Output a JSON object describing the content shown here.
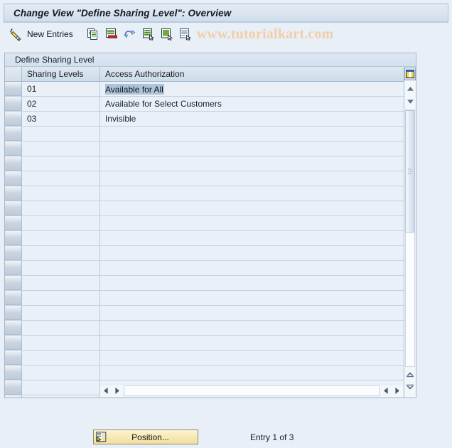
{
  "window": {
    "title": "Change View \"Define Sharing Level\": Overview"
  },
  "toolbar": {
    "edit_icon": "pencil-icon",
    "new_entries_label": "New Entries",
    "buttons": [
      {
        "name": "copy-icon",
        "title": "Copy As..."
      },
      {
        "name": "delete-icon",
        "title": "Delete"
      },
      {
        "name": "undo-icon",
        "title": "Undo Change"
      },
      {
        "name": "select-all-icon",
        "title": "Select All"
      },
      {
        "name": "select-block-icon",
        "title": "Select Block"
      },
      {
        "name": "deselect-all-icon",
        "title": "Deselect All"
      }
    ],
    "watermark": "www.tutorialkart.com"
  },
  "panel": {
    "header": "Define Sharing Level"
  },
  "table": {
    "columns": [
      "Sharing Levels",
      "Access Authorization"
    ],
    "config_icon": "table-settings-icon",
    "rows": [
      {
        "level": "01",
        "authorization": "Available for All",
        "selected": true
      },
      {
        "level": "02",
        "authorization": "Available for Select Customers",
        "selected": false
      },
      {
        "level": "03",
        "authorization": "Invisible",
        "selected": false
      }
    ],
    "blank_row_count": 19
  },
  "scrollbars": {
    "up_icon": "scroll-up-icon",
    "down_icon": "scroll-down-icon",
    "page_up_icon": "page-up-icon",
    "page_down_icon": "page-down-icon",
    "left_icon": "scroll-left-icon",
    "right_icon": "scroll-right-icon"
  },
  "footer": {
    "position_label": "Position...",
    "position_icon": "position-icon",
    "entry_status": "Entry 1 of 3"
  },
  "colors": {
    "title_bar": "#dbe5f0",
    "page_background": "#e9eff6",
    "grid_cell": "#eaf0f7",
    "selection_highlight": "#aec3d8",
    "watermark": "#f0ceaa",
    "button_yellow": "#f7e9b4"
  }
}
